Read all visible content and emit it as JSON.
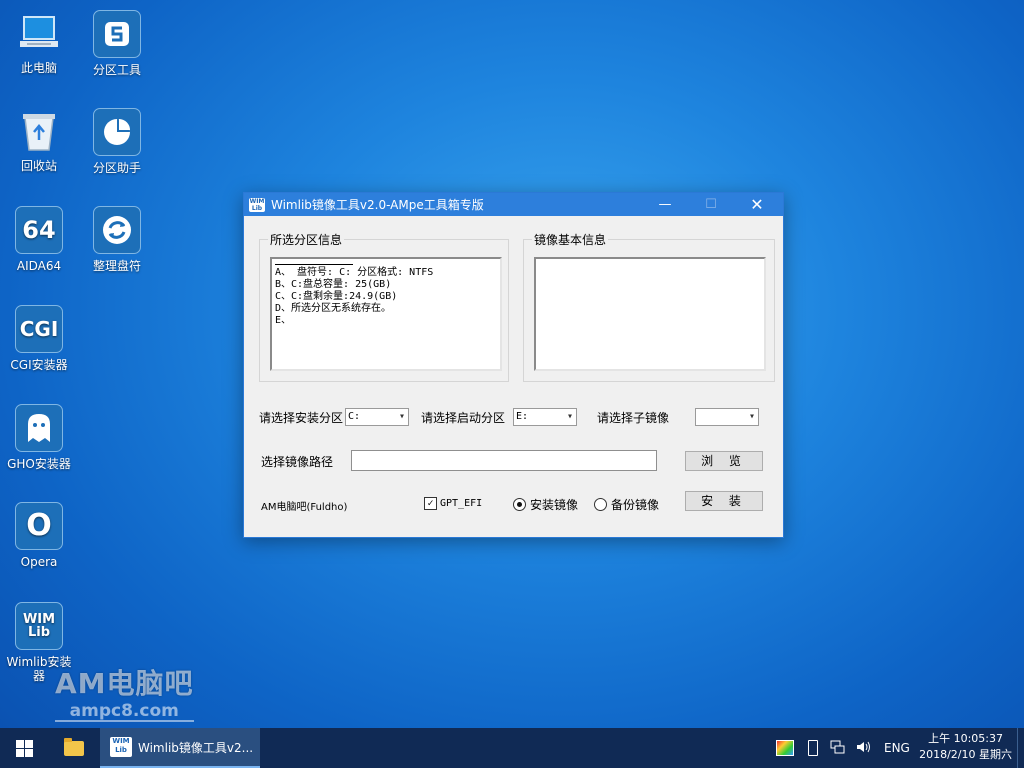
{
  "desktop": {
    "icons": [
      {
        "label": "此电脑",
        "icon": "computer-icon"
      },
      {
        "label": "分区工具",
        "icon": "partition-tool-icon"
      },
      {
        "label": "回收站",
        "icon": "recycle-bin-icon"
      },
      {
        "label": "分区助手",
        "icon": "partition-assistant-icon"
      },
      {
        "label": "AIDA64",
        "icon": "aida64-icon",
        "glyph": "64"
      },
      {
        "label": "整理盘符",
        "icon": "refresh-icon"
      },
      {
        "label": "CGI安装器",
        "icon": "cgi-icon",
        "glyph": "CGI"
      },
      {
        "label": "GHO安装器",
        "icon": "ghost-icon"
      },
      {
        "label": "Opera",
        "icon": "opera-icon",
        "glyph": "O"
      },
      {
        "label": "Wimlib安装器",
        "icon": "wimlib-icon",
        "glyph1": "WIM",
        "glyph2": "Lib"
      }
    ]
  },
  "watermark": {
    "big": "AM电脑吧",
    "small": "ampc8.com"
  },
  "window": {
    "title": "Wimlib镜像工具v2.0-AMpe工具箱专版",
    "app_icon_text1": "WIM",
    "app_icon_text2": "Lib",
    "minimize": "—",
    "maximize": "☐",
    "close": "✕",
    "partition_group": {
      "label": "所选分区信息",
      "lines": [
        "A、 盘符号: C: 分区格式: NTFS",
        "B、C:盘总容量: 25(GB)",
        "C、C:盘剩余量:24.9(GB)",
        "D、所选分区无系统存在。",
        "E、"
      ]
    },
    "image_group": {
      "label": "镜像基本信息"
    },
    "install_partition_label": "请选择安装分区",
    "install_partition_value": "C:",
    "boot_partition_label": "请选择启动分区",
    "boot_partition_value": "E:",
    "sub_image_label": "请选择子镜像",
    "sub_image_value": "",
    "image_path_label": "选择镜像路径",
    "image_path_value": "",
    "browse_button": "浏 览",
    "footer_label": "AM电脑吧(Fuldho)",
    "gpt_efi_label": "GPT_EFI",
    "gpt_efi_checked": "✓",
    "radio_install": "安装镜像",
    "radio_backup": "备份镜像",
    "install_button": "安 装"
  },
  "taskbar": {
    "app_icon_text1": "WIM",
    "app_icon_text2": "Lib",
    "app_label": "Wimlib镜像工具v2...",
    "language": "ENG",
    "time": "上午 10:05:37",
    "date": "2018/2/10 星期六"
  }
}
